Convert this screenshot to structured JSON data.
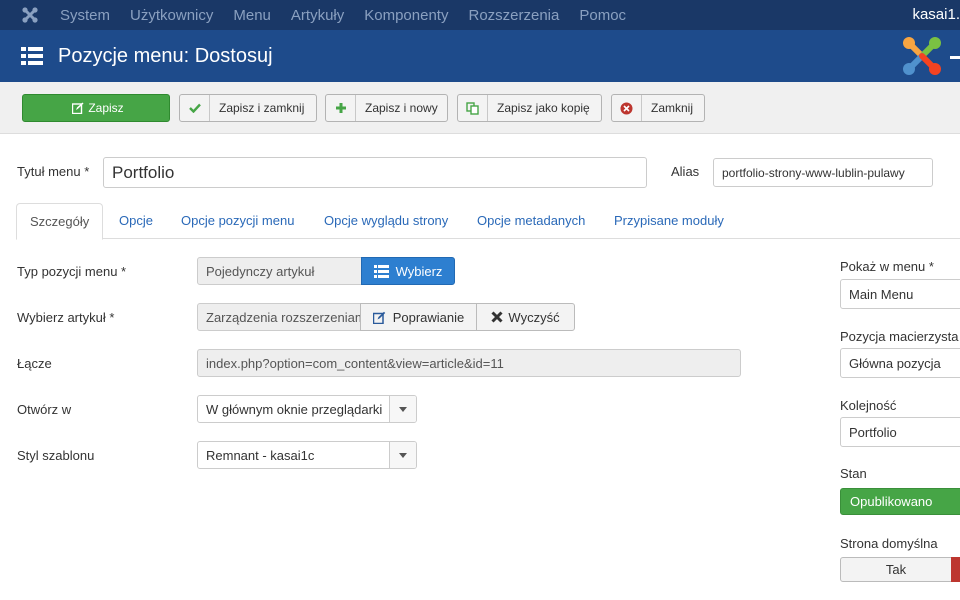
{
  "topnav": {
    "items": [
      "System",
      "Użytkownicy",
      "Menu",
      "Artykuły",
      "Komponenty",
      "Rozszerzenia",
      "Pomoc"
    ],
    "user": "kasai1."
  },
  "titlebar": {
    "title": "Pozycje menu: Dostosuj"
  },
  "toolbar": {
    "save": "Zapisz",
    "save_close": "Zapisz i zamknij",
    "save_new": "Zapisz i nowy",
    "save_copy": "Zapisz jako kopię",
    "close": "Zamknij"
  },
  "header": {
    "title_label": "Tytuł menu *",
    "title_value": "Portfolio",
    "alias_label": "Alias",
    "alias_value": "portfolio-strony-www-lublin-pulawy"
  },
  "tabs": [
    "Szczegóły",
    "Opcje",
    "Opcje pozycji menu",
    "Opcje wyglądu strony",
    "Opcje metadanych",
    "Przypisane moduły"
  ],
  "details": {
    "type_label": "Typ pozycji menu *",
    "type_value": "Pojedynczy artykuł",
    "type_button": "Wybierz",
    "article_label": "Wybierz artykuł *",
    "article_value": "Zarządzenia rozszerzeniami",
    "edit_button": "Poprawianie",
    "clear_button": "Wyczyść",
    "link_label": "Łącze",
    "link_value": "index.php?option=com_content&view=article&id=11",
    "open_label": "Otwórz w",
    "open_value": "W głównym oknie przeglądarki",
    "template_label": "Styl szablonu",
    "template_value": "Remnant - kasai1c"
  },
  "sidebar": {
    "menu_label": "Pokaż w menu *",
    "menu_value": "Main Menu",
    "parent_label": "Pozycja macierzysta",
    "parent_value": "Główna pozycja",
    "order_label": "Kolejność",
    "order_value": "Portfolio",
    "status_label": "Stan",
    "status_value": "Opublikowano",
    "default_label": "Strona domyślna",
    "default_yes": "Tak"
  },
  "colors": {
    "nav_bg": "#1a3867",
    "title_bg": "#1e4b8b",
    "success": "#46a546",
    "primary": "#2d7fd0",
    "danger": "#bd362f"
  }
}
